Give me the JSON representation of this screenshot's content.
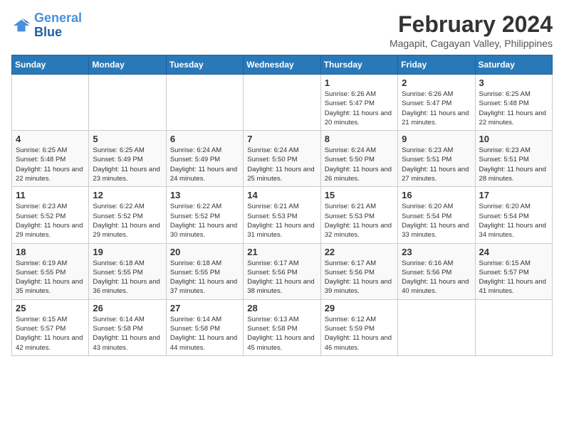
{
  "header": {
    "logo_line1": "General",
    "logo_line2": "Blue",
    "main_title": "February 2024",
    "subtitle": "Magapit, Cagayan Valley, Philippines"
  },
  "days_of_week": [
    "Sunday",
    "Monday",
    "Tuesday",
    "Wednesday",
    "Thursday",
    "Friday",
    "Saturday"
  ],
  "weeks": [
    [
      {
        "day": "",
        "info": ""
      },
      {
        "day": "",
        "info": ""
      },
      {
        "day": "",
        "info": ""
      },
      {
        "day": "",
        "info": ""
      },
      {
        "day": "1",
        "info": "Sunrise: 6:26 AM\nSunset: 5:47 PM\nDaylight: 11 hours and 20 minutes."
      },
      {
        "day": "2",
        "info": "Sunrise: 6:26 AM\nSunset: 5:47 PM\nDaylight: 11 hours and 21 minutes."
      },
      {
        "day": "3",
        "info": "Sunrise: 6:25 AM\nSunset: 5:48 PM\nDaylight: 11 hours and 22 minutes."
      }
    ],
    [
      {
        "day": "4",
        "info": "Sunrise: 6:25 AM\nSunset: 5:48 PM\nDaylight: 11 hours and 22 minutes."
      },
      {
        "day": "5",
        "info": "Sunrise: 6:25 AM\nSunset: 5:49 PM\nDaylight: 11 hours and 23 minutes."
      },
      {
        "day": "6",
        "info": "Sunrise: 6:24 AM\nSunset: 5:49 PM\nDaylight: 11 hours and 24 minutes."
      },
      {
        "day": "7",
        "info": "Sunrise: 6:24 AM\nSunset: 5:50 PM\nDaylight: 11 hours and 25 minutes."
      },
      {
        "day": "8",
        "info": "Sunrise: 6:24 AM\nSunset: 5:50 PM\nDaylight: 11 hours and 26 minutes."
      },
      {
        "day": "9",
        "info": "Sunrise: 6:23 AM\nSunset: 5:51 PM\nDaylight: 11 hours and 27 minutes."
      },
      {
        "day": "10",
        "info": "Sunrise: 6:23 AM\nSunset: 5:51 PM\nDaylight: 11 hours and 28 minutes."
      }
    ],
    [
      {
        "day": "11",
        "info": "Sunrise: 6:23 AM\nSunset: 5:52 PM\nDaylight: 11 hours and 29 minutes."
      },
      {
        "day": "12",
        "info": "Sunrise: 6:22 AM\nSunset: 5:52 PM\nDaylight: 11 hours and 29 minutes."
      },
      {
        "day": "13",
        "info": "Sunrise: 6:22 AM\nSunset: 5:52 PM\nDaylight: 11 hours and 30 minutes."
      },
      {
        "day": "14",
        "info": "Sunrise: 6:21 AM\nSunset: 5:53 PM\nDaylight: 11 hours and 31 minutes."
      },
      {
        "day": "15",
        "info": "Sunrise: 6:21 AM\nSunset: 5:53 PM\nDaylight: 11 hours and 32 minutes."
      },
      {
        "day": "16",
        "info": "Sunrise: 6:20 AM\nSunset: 5:54 PM\nDaylight: 11 hours and 33 minutes."
      },
      {
        "day": "17",
        "info": "Sunrise: 6:20 AM\nSunset: 5:54 PM\nDaylight: 11 hours and 34 minutes."
      }
    ],
    [
      {
        "day": "18",
        "info": "Sunrise: 6:19 AM\nSunset: 5:55 PM\nDaylight: 11 hours and 35 minutes."
      },
      {
        "day": "19",
        "info": "Sunrise: 6:18 AM\nSunset: 5:55 PM\nDaylight: 11 hours and 36 minutes."
      },
      {
        "day": "20",
        "info": "Sunrise: 6:18 AM\nSunset: 5:55 PM\nDaylight: 11 hours and 37 minutes."
      },
      {
        "day": "21",
        "info": "Sunrise: 6:17 AM\nSunset: 5:56 PM\nDaylight: 11 hours and 38 minutes."
      },
      {
        "day": "22",
        "info": "Sunrise: 6:17 AM\nSunset: 5:56 PM\nDaylight: 11 hours and 39 minutes."
      },
      {
        "day": "23",
        "info": "Sunrise: 6:16 AM\nSunset: 5:56 PM\nDaylight: 11 hours and 40 minutes."
      },
      {
        "day": "24",
        "info": "Sunrise: 6:15 AM\nSunset: 5:57 PM\nDaylight: 11 hours and 41 minutes."
      }
    ],
    [
      {
        "day": "25",
        "info": "Sunrise: 6:15 AM\nSunset: 5:57 PM\nDaylight: 11 hours and 42 minutes."
      },
      {
        "day": "26",
        "info": "Sunrise: 6:14 AM\nSunset: 5:58 PM\nDaylight: 11 hours and 43 minutes."
      },
      {
        "day": "27",
        "info": "Sunrise: 6:14 AM\nSunset: 5:58 PM\nDaylight: 11 hours and 44 minutes."
      },
      {
        "day": "28",
        "info": "Sunrise: 6:13 AM\nSunset: 5:58 PM\nDaylight: 11 hours and 45 minutes."
      },
      {
        "day": "29",
        "info": "Sunrise: 6:12 AM\nSunset: 5:59 PM\nDaylight: 11 hours and 46 minutes."
      },
      {
        "day": "",
        "info": ""
      },
      {
        "day": "",
        "info": ""
      }
    ]
  ]
}
